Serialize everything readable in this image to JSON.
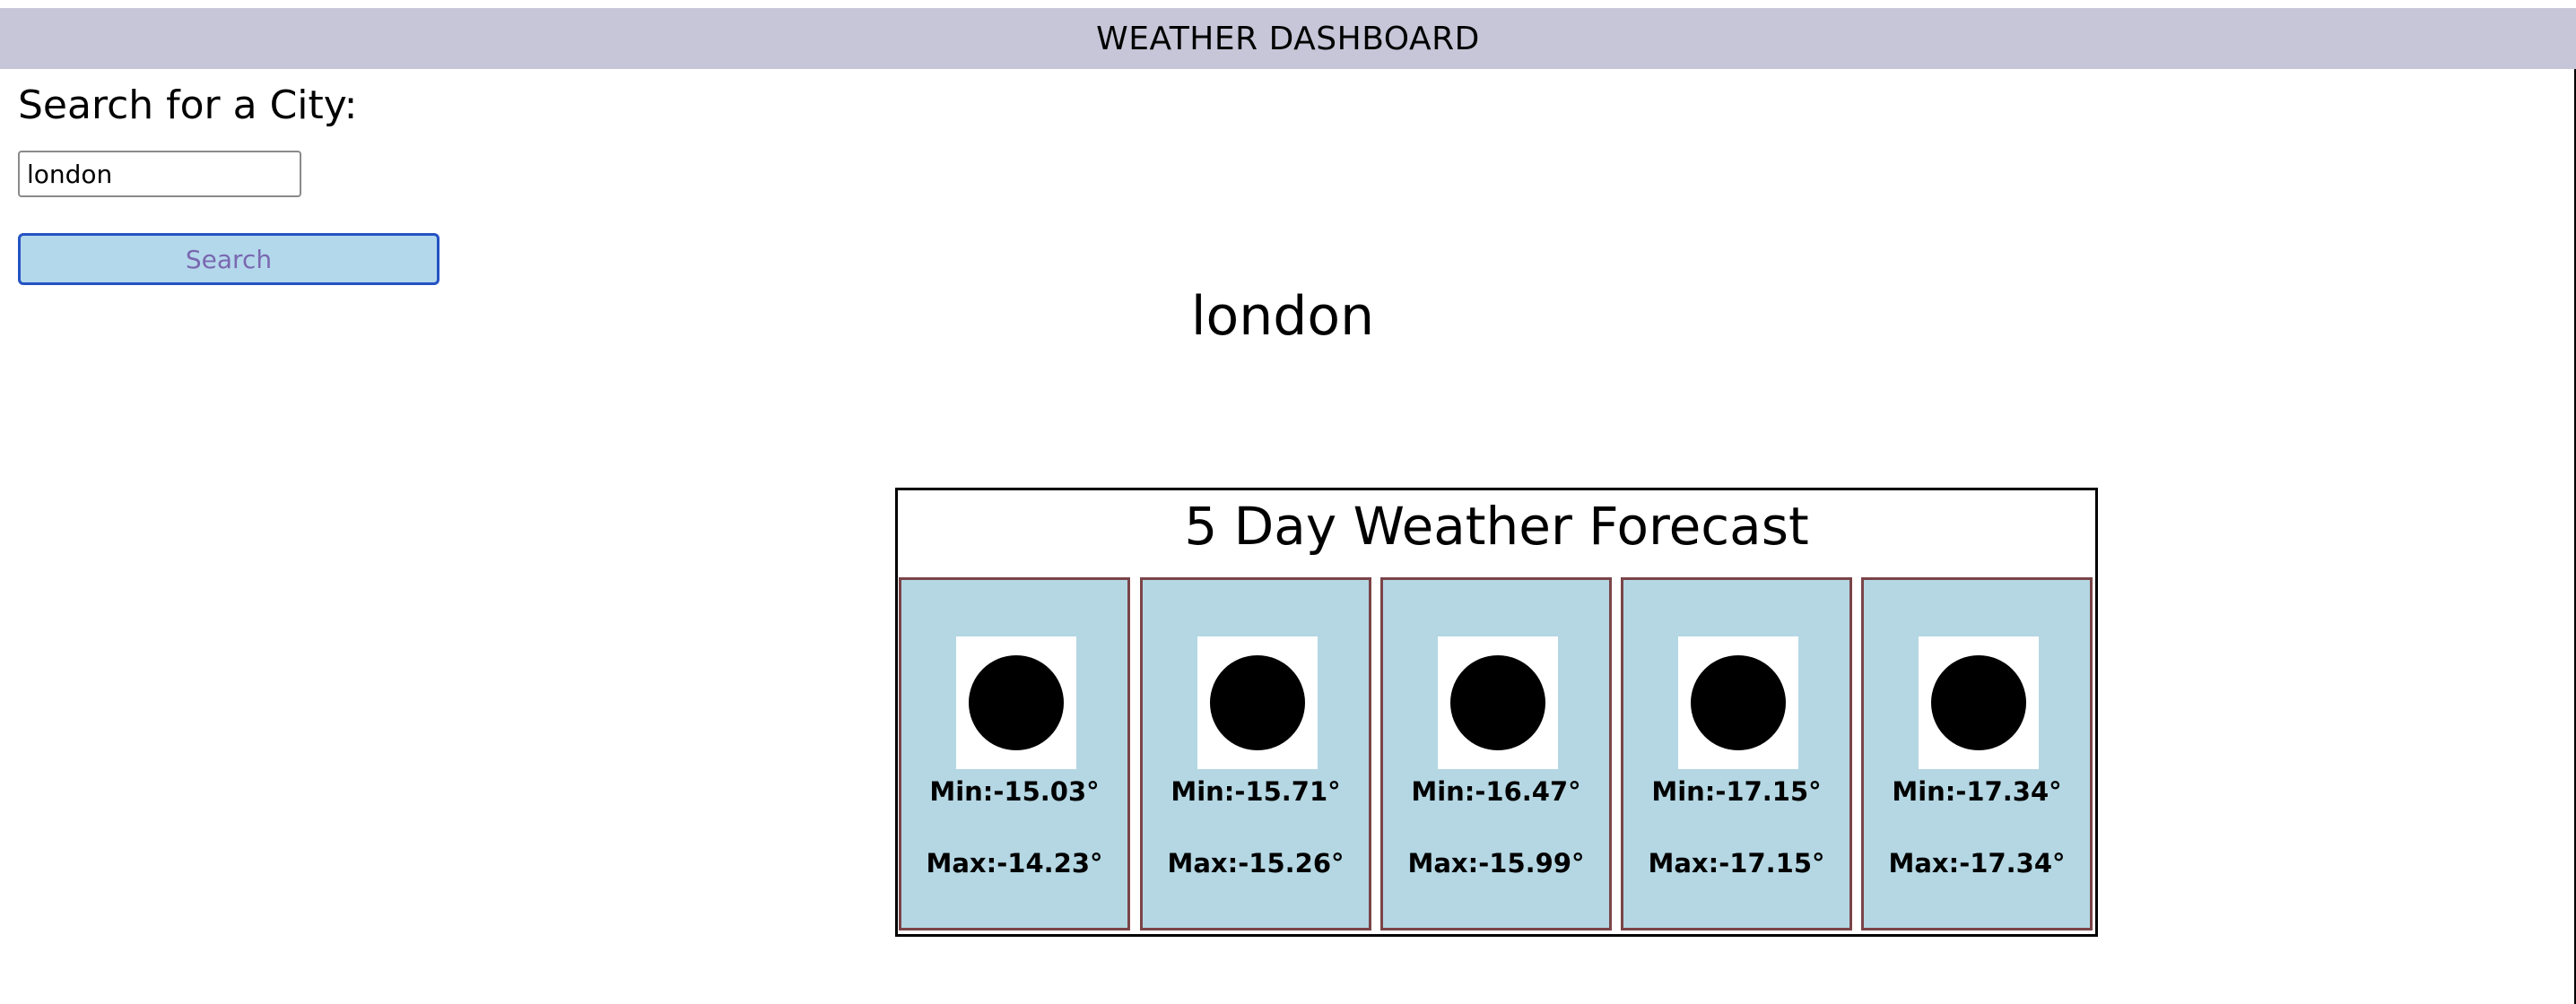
{
  "header": {
    "title": "WEATHER DASHBOARD"
  },
  "search": {
    "heading": "Search for a City:",
    "input_value": "london",
    "button_label": "Search"
  },
  "city": {
    "name": "london"
  },
  "forecast": {
    "title": "5 Day Weather Forecast",
    "days": [
      {
        "icon": "weather-icon",
        "min": "Min:-15.03°",
        "max": "Max:-14.23°"
      },
      {
        "icon": "weather-icon",
        "min": "Min:-15.71°",
        "max": "Max:-15.26°"
      },
      {
        "icon": "weather-icon",
        "min": "Min:-16.47°",
        "max": "Max:-15.99°"
      },
      {
        "icon": "weather-icon",
        "min": "Min:-17.15°",
        "max": "Max:-17.15°"
      },
      {
        "icon": "weather-icon",
        "min": "Min:-17.34°",
        "max": "Max:-17.34°"
      }
    ]
  },
  "colors": {
    "header_bg": "#c6c6d8",
    "card_bg": "#b4d7e3",
    "card_border": "#7a4448",
    "button_bg": "#b3d8eb",
    "button_border": "#2553c4",
    "button_text": "#7a68b0"
  }
}
